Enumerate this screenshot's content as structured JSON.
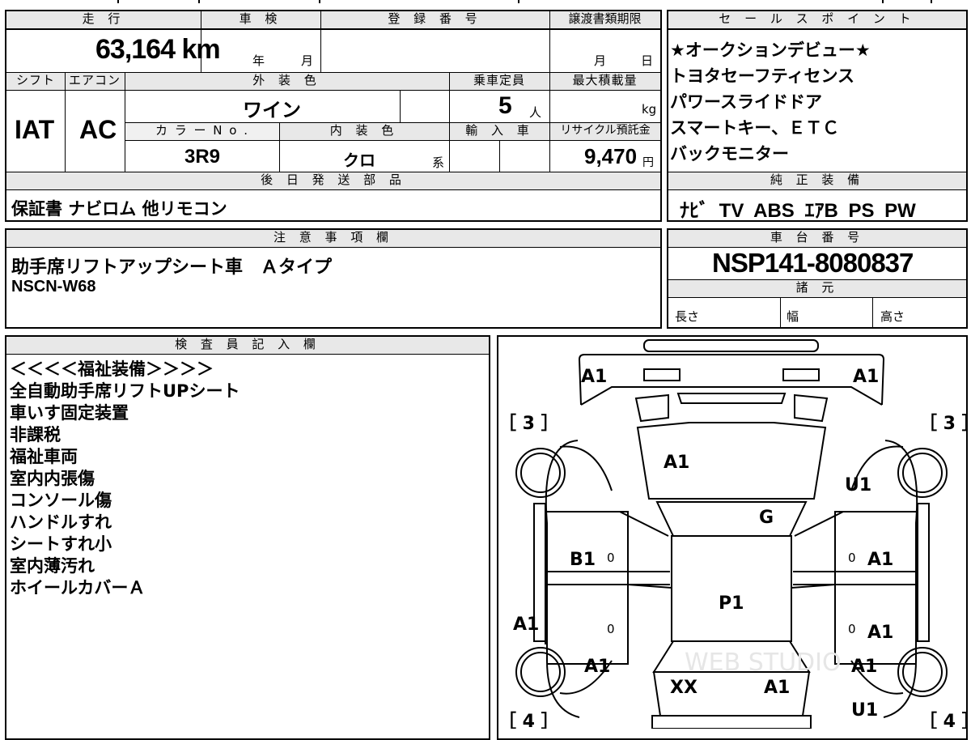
{
  "top_left": {
    "headers": {
      "mileage": "走 行",
      "shaken": "車 検",
      "registration": "登 録 番 号",
      "transfer_deadline": "譲渡書類期限",
      "shift": "シフト",
      "aircon": "エアコン",
      "exterior_color": "外 装 色",
      "capacity": "乗車定員",
      "max_load": "最大積載量",
      "color_no": "カ ラ ー N o .",
      "interior_color": "内 装 色",
      "import": "輸 入 車",
      "recycle_fee": "リサイクル預託金",
      "later_parts": "後 日 発 送 部 品"
    },
    "values": {
      "mileage": "63,164 km",
      "shaken_year_unit": "年",
      "shaken_month_unit": "月",
      "deadline_month_unit": "月",
      "deadline_day_unit": "日",
      "shift": "IAT",
      "aircon": "AC",
      "exterior_color": "ワイン",
      "capacity": "5",
      "capacity_unit": "人",
      "max_load_unit": "kg",
      "color_no": "3R9",
      "interior_color": "クロ",
      "interior_suffix": "系",
      "recycle_fee": "9,470",
      "recycle_unit": "円",
      "later_parts": "保証書 ナビロム 他リモコン"
    }
  },
  "sales_points": {
    "header": "セ ー ル ス ポ イ ン ト",
    "items": [
      "★オークションデビュー★",
      "トヨタセーフティセンス",
      "パワースライドドア",
      "スマートキー、ＥＴＣ",
      "バックモニター"
    ],
    "equipment_header": "純 正 装 備",
    "equipment": "ﾅﾋﾞ TV ABS ｴｱB PS PW"
  },
  "notes": {
    "header": "注 意 事 項 欄",
    "line1": "助手席リフトアップシート車　Ａタイプ",
    "line2": "NSCN-W68"
  },
  "chassis": {
    "header": "車 台 番 号",
    "number": "NSP141-8080837",
    "specs_header": "諸 元",
    "length": "長さ",
    "width": "幅",
    "height": "高さ"
  },
  "inspector": {
    "header": "検 査 員 記 入 欄",
    "lines": [
      "＜＜＜＜福祉装備＞＞＞＞",
      "全自動助手席リフトUPシート",
      "車いす固定装置",
      "非課税",
      "福祉車両",
      "室内内張傷",
      "コンソール傷",
      "ハンドルすれ",
      "シートすれ小",
      "室内薄汚れ",
      "ホイールカバーＡ"
    ]
  },
  "diagram": {
    "labels": {
      "front_left": "A1",
      "front_right": "A1",
      "tire_fl": "［ 3 ］",
      "tire_fr": "［ 3 ］",
      "hood": "A1",
      "fender_fr": "U1",
      "windshield": "G",
      "door_fl": "B1",
      "door_fr": "A1",
      "roof": "P1",
      "rocker_l": "A1",
      "door_rr": "A1",
      "qtr_l": "A1",
      "qtr_r": "A1",
      "rear_glass": "XX",
      "trunk": "A1",
      "rear_r": "U1",
      "tire_rl": "［ 4 ］",
      "tire_rr": "［ 4 ］",
      "zero1": "0",
      "zero2": "0",
      "zero3": "0",
      "zero4": "0"
    }
  },
  "watermark": "WEB STUDIO"
}
